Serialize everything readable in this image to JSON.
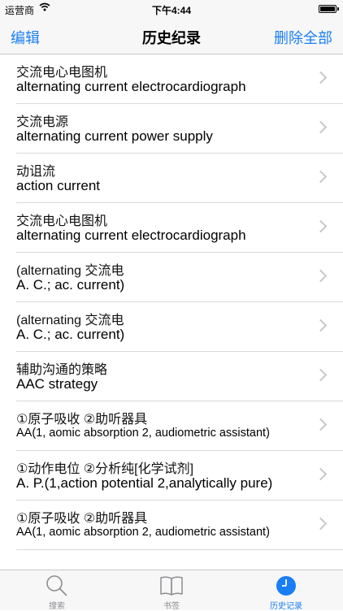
{
  "status_bar": {
    "carrier": "运营商",
    "time": "下午4:44"
  },
  "nav": {
    "left_label": "编辑",
    "title": "历史纪录",
    "right_label": "删除全部"
  },
  "history": [
    {
      "zh": "交流电心电图机",
      "en": "alternating current electrocardiograph"
    },
    {
      "zh": "交流电源",
      "en": "alternating current power supply"
    },
    {
      "zh": "动诅流",
      "en": "action current"
    },
    {
      "zh": "交流电心电图机",
      "en": "alternating current electrocardiograph"
    },
    {
      "zh": "(alternating 交流电",
      "en": "A. C.; ac. current)"
    },
    {
      "zh": "(alternating 交流电",
      "en": "A. C.; ac. current)"
    },
    {
      "zh": "辅助沟通的策略",
      "en": "AAC strategy"
    },
    {
      "zh": "①原子吸收 ②助听器具",
      "en": "AA(1, aomic absorption 2, audiometric assistant)"
    },
    {
      "zh": "①动作电位 ②分析纯[化学试剂]",
      "en": "A. P.(1,action potential 2,analytically pure)"
    },
    {
      "zh": "①原子吸收 ②助听器具",
      "en": "AA(1, aomic absorption 2, audiometric assistant)"
    }
  ],
  "tabs": [
    {
      "label": "搜索",
      "icon": "search-icon",
      "active": false
    },
    {
      "label": "书签",
      "icon": "book-icon",
      "active": false
    },
    {
      "label": "历史记录",
      "icon": "clock-icon",
      "active": true
    }
  ],
  "colors": {
    "accent": "#1a7ff5",
    "inactive": "#8e8e93"
  }
}
